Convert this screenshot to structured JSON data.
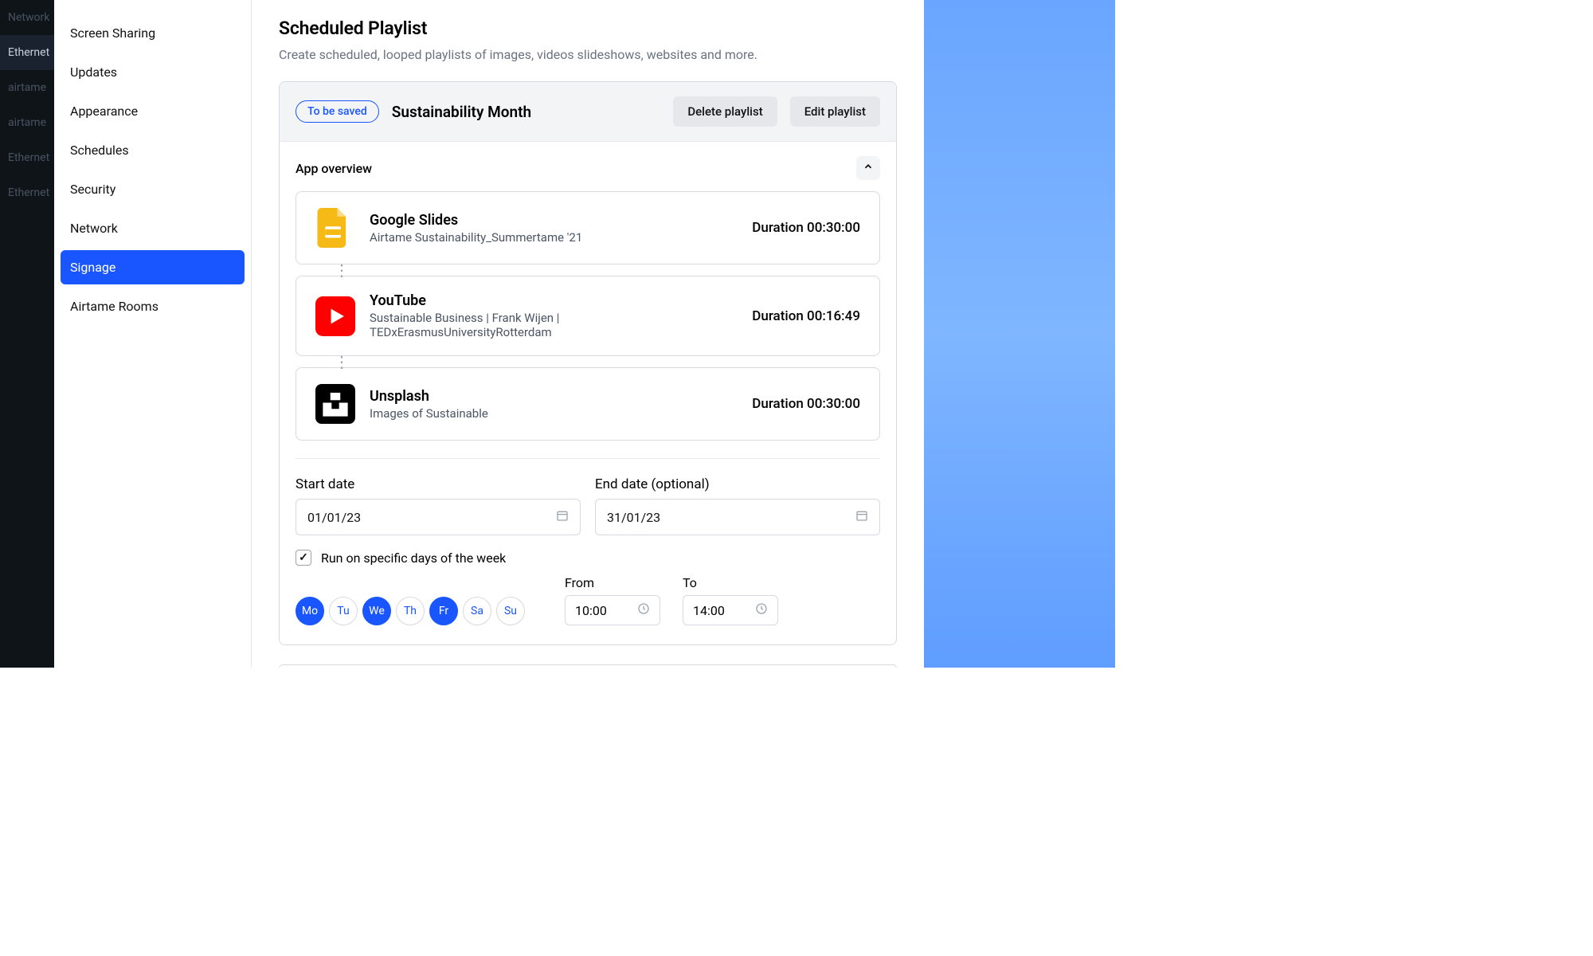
{
  "rail": {
    "items": [
      {
        "label": "Network",
        "active": false
      },
      {
        "label": "Ethernet",
        "active": true
      },
      {
        "label": "airtame",
        "active": false
      },
      {
        "label": "airtame",
        "active": false
      },
      {
        "label": "Ethernet",
        "active": false
      },
      {
        "label": "Ethernet",
        "active": false
      }
    ]
  },
  "sidebar": {
    "items": [
      {
        "label": "Screen Sharing",
        "selected": false
      },
      {
        "label": "Updates",
        "selected": false
      },
      {
        "label": "Appearance",
        "selected": false
      },
      {
        "label": "Schedules",
        "selected": false
      },
      {
        "label": "Security",
        "selected": false
      },
      {
        "label": "Network",
        "selected": false
      },
      {
        "label": "Signage",
        "selected": true
      },
      {
        "label": "Airtame Rooms",
        "selected": false
      }
    ]
  },
  "page": {
    "title": "Scheduled Playlist",
    "subtitle": "Create scheduled, looped playlists of images, videos slideshows, websites and more."
  },
  "playlist": {
    "chip": "To be saved",
    "name": "Sustainability Month",
    "delete_label": "Delete playlist",
    "edit_label": "Edit playlist",
    "section_label": "App overview",
    "apps": [
      {
        "title": "Google Slides",
        "sub": "Airtame Sustainability_Summertame '21",
        "duration": "Duration 00:30:00",
        "icon": "gslides"
      },
      {
        "title": "YouTube",
        "sub": "Sustainable Business | Frank Wijen | TEDxErasmusUniversityRotterdam",
        "duration": "Duration 00:16:49",
        "icon": "youtube"
      },
      {
        "title": "Unsplash",
        "sub": "Images of Sustainable",
        "duration": "Duration 00:30:00",
        "icon": "unsplash"
      }
    ]
  },
  "schedule": {
    "start_label": "Start date",
    "end_label": "End date (optional)",
    "start_value": "01/01/23",
    "end_value": "31/01/23",
    "run_specific_label": "Run on specific days of the week",
    "run_specific_checked": true,
    "days": [
      {
        "abbr": "Mo",
        "on": true
      },
      {
        "abbr": "Tu",
        "on": false
      },
      {
        "abbr": "We",
        "on": true
      },
      {
        "abbr": "Th",
        "on": false
      },
      {
        "abbr": "Fr",
        "on": true
      },
      {
        "abbr": "Sa",
        "on": false
      },
      {
        "abbr": "Su",
        "on": false
      }
    ],
    "from_label": "From",
    "to_label": "To",
    "from_value": "10:00",
    "to_value": "14:00"
  }
}
